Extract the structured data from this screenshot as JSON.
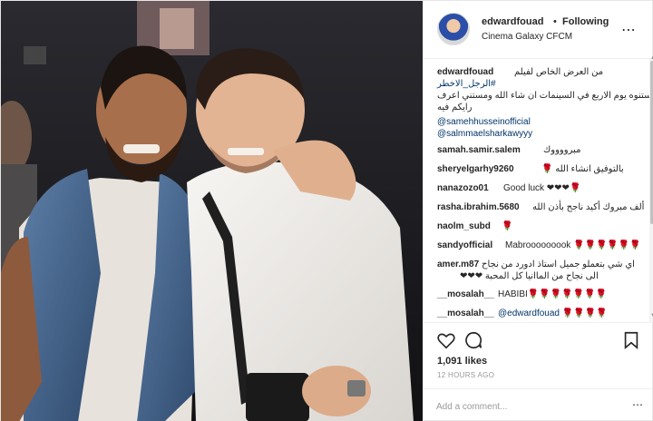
{
  "header": {
    "username": "edwardfouad",
    "separator": "•",
    "follow_status": "Following",
    "location": "Cinema Galaxy CFCM",
    "more_icon": "ellipsis-icon"
  },
  "caption": {
    "username": "edwardfouad",
    "line1": "من العرض الخاص لفيلم",
    "hashtag": "#الرجل_الاخطر",
    "line3": "استنوه يوم الاربع في السينمات ان شاء الله ومستني اعرف",
    "line4": "رايكم فيه",
    "mention1": "@samehhusseinofficial",
    "mention2": "@salmmaelsharkawyyy"
  },
  "comments": [
    {
      "user": "samah.samir.salem",
      "text": "مبرووووك"
    },
    {
      "user": "sheryelgarhy9260",
      "text": "بالتوفيق انشاء الله 🌹"
    },
    {
      "user": "nanazozo01",
      "text": "Good luck ❤❤❤🌹"
    },
    {
      "user": "rasha.ibrahim.5680",
      "text": "ألف مبروك أكيد ناجح بأذن الله"
    },
    {
      "user": "naolm_subd",
      "text": "🌹"
    },
    {
      "user": "sandyofficial",
      "text": "Mabrooooooook 🌹🌹🌹🌹🌹🌹"
    },
    {
      "user": "amer.m87",
      "text": "اي شي بتعملو جميل استاذ ادورد من نجاح",
      "text2": "الى نجاح من الماانيا كل المحبة ❤❤❤"
    },
    {
      "user": "__mosalah__",
      "text": "HABIBI🌹🌹🌹🌹🌹🌹🌹"
    },
    {
      "user": "__mosalah__",
      "text": "@edwardfouad 🌹🌹🌹🌹"
    }
  ],
  "actions": {
    "like_icon": "heart-icon",
    "comment_icon": "comment-icon",
    "save_icon": "bookmark-icon",
    "likes_count": "1,091",
    "likes_label": "likes",
    "timestamp": "12 HOURS AGO",
    "comment_placeholder": "Add a comment...",
    "more_icon": "ellipsis-icon"
  },
  "colors": {
    "text": "#262626",
    "link": "#003569",
    "muted": "#999999",
    "border": "#efefef"
  }
}
